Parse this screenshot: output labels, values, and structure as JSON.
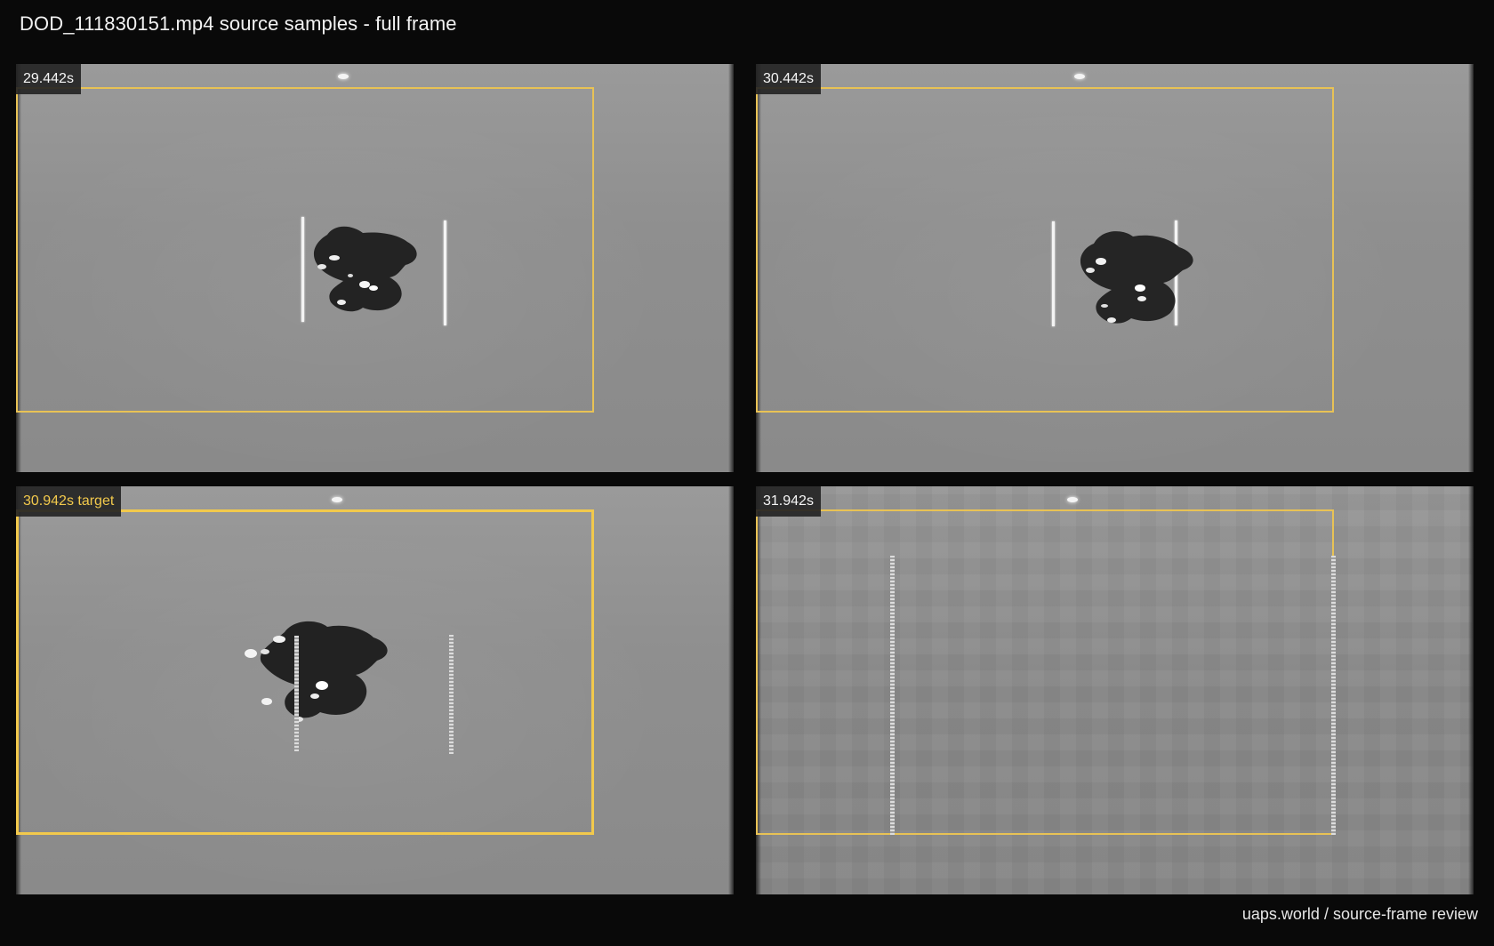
{
  "header": {
    "title": "DOD_111830151.mp4 source samples - full frame"
  },
  "panels": [
    {
      "time_label": "29.442s",
      "is_target": false
    },
    {
      "time_label": "30.442s",
      "is_target": false
    },
    {
      "time_label": "30.942s target",
      "is_target": true
    },
    {
      "time_label": "31.942s",
      "is_target": false
    }
  ],
  "footer": {
    "credit": "uaps.world / source-frame review"
  },
  "colors": {
    "background": "#090909",
    "crop_box": "#e8c255",
    "target_highlight": "#f2c94c",
    "label_text": "#f5f5f5"
  }
}
